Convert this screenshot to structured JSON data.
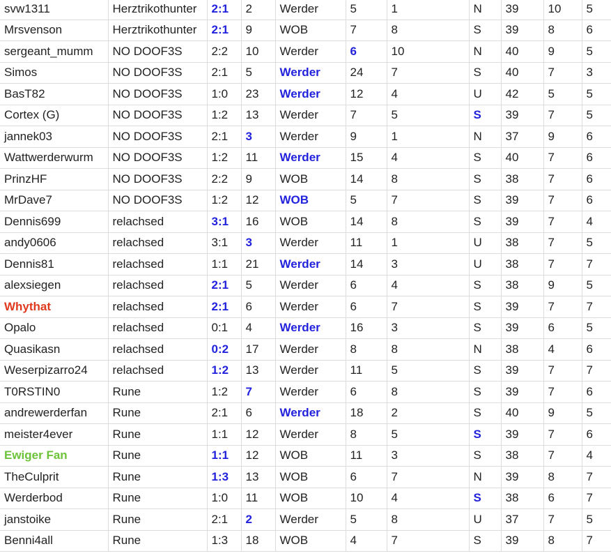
{
  "styles": {
    "highlight_color": "#2222dd",
    "name_red": "#e03a1e",
    "name_green": "#6cc33a",
    "border_color": "#dcdcdc"
  },
  "rows": [
    {
      "name": "svw1311",
      "team": "Herztrikothunter",
      "tip": "2:1",
      "c4": "2",
      "club": "Werder",
      "c6": "5",
      "c7": "1",
      "c8": "N",
      "c9": "39",
      "c10": "10",
      "c11": "5",
      "hl": [
        "tip"
      ]
    },
    {
      "name": "Mrsvenson",
      "team": "Herztrikothunter",
      "tip": "2:1",
      "c4": "9",
      "club": "WOB",
      "c6": "7",
      "c7": "8",
      "c8": "S",
      "c9": "39",
      "c10": "8",
      "c11": "6",
      "hl": [
        "tip"
      ]
    },
    {
      "name": "sergeant_mumm",
      "team": "NO DOOF3S",
      "tip": "2:2",
      "c4": "10",
      "club": "Werder",
      "c6": "6",
      "c7": "10",
      "c8": "N",
      "c9": "40",
      "c10": "9",
      "c11": "5",
      "hl": [
        "c6"
      ]
    },
    {
      "name": "Simos",
      "team": "NO DOOF3S",
      "tip": "2:1",
      "c4": "5",
      "club": "Werder",
      "c6": "24",
      "c7": "7",
      "c8": "S",
      "c9": "40",
      "c10": "7",
      "c11": "3",
      "hl": [
        "club"
      ]
    },
    {
      "name": "BasT82",
      "team": "NO DOOF3S",
      "tip": "1:0",
      "c4": "23",
      "club": "Werder",
      "c6": "12",
      "c7": "4",
      "c8": "U",
      "c9": "42",
      "c10": "5",
      "c11": "5",
      "hl": [
        "club"
      ]
    },
    {
      "name": "Cortex (G)",
      "team": "NO DOOF3S",
      "tip": "1:2",
      "c4": "13",
      "club": "Werder",
      "c6": "7",
      "c7": "5",
      "c8": "S",
      "c9": "39",
      "c10": "7",
      "c11": "5",
      "hl": [
        "c8"
      ]
    },
    {
      "name": "jannek03",
      "team": "NO DOOF3S",
      "tip": "2:1",
      "c4": "3",
      "club": "Werder",
      "c6": "9",
      "c7": "1",
      "c8": "N",
      "c9": "37",
      "c10": "9",
      "c11": "6",
      "hl": [
        "c4"
      ]
    },
    {
      "name": "Wattwerderwurm",
      "team": "NO DOOF3S",
      "tip": "1:2",
      "c4": "11",
      "club": "Werder",
      "c6": "15",
      "c7": "4",
      "c8": "S",
      "c9": "40",
      "c10": "7",
      "c11": "6",
      "hl": [
        "club"
      ]
    },
    {
      "name": "PrinzHF",
      "team": "NO DOOF3S",
      "tip": "2:2",
      "c4": "9",
      "club": "WOB",
      "c6": "14",
      "c7": "8",
      "c8": "S",
      "c9": "38",
      "c10": "7",
      "c11": "6",
      "hl": []
    },
    {
      "name": "MrDave7",
      "team": "NO DOOF3S",
      "tip": "1:2",
      "c4": "12",
      "club": "WOB",
      "c6": "5",
      "c7": "7",
      "c8": "S",
      "c9": "39",
      "c10": "7",
      "c11": "6",
      "hl": [
        "club"
      ]
    },
    {
      "name": "Dennis699",
      "team": "relachsed",
      "tip": "3:1",
      "c4": "16",
      "club": "WOB",
      "c6": "14",
      "c7": "8",
      "c8": "S",
      "c9": "39",
      "c10": "7",
      "c11": "4",
      "hl": [
        "tip"
      ]
    },
    {
      "name": "andy0606",
      "team": "relachsed",
      "tip": "3:1",
      "c4": "3",
      "club": "Werder",
      "c6": "11",
      "c7": "1",
      "c8": "U",
      "c9": "38",
      "c10": "7",
      "c11": "5",
      "hl": [
        "c4"
      ]
    },
    {
      "name": "Dennis81",
      "team": "relachsed",
      "tip": "1:1",
      "c4": "21",
      "club": "Werder",
      "c6": "14",
      "c7": "3",
      "c8": "U",
      "c9": "38",
      "c10": "7",
      "c11": "7",
      "hl": [
        "club"
      ]
    },
    {
      "name": "alexsiegen",
      "team": "relachsed",
      "tip": "2:1",
      "c4": "5",
      "club": "Werder",
      "c6": "6",
      "c7": "4",
      "c8": "S",
      "c9": "38",
      "c10": "9",
      "c11": "5",
      "hl": [
        "tip"
      ]
    },
    {
      "name": "Whythat",
      "team": "relachsed",
      "tip": "2:1",
      "c4": "6",
      "club": "Werder",
      "c6": "6",
      "c7": "7",
      "c8": "S",
      "c9": "39",
      "c10": "7",
      "c11": "7",
      "hl": [
        "tip"
      ],
      "name_color": "red"
    },
    {
      "name": "Opalo",
      "team": "relachsed",
      "tip": "0:1",
      "c4": "4",
      "club": "Werder",
      "c6": "16",
      "c7": "3",
      "c8": "S",
      "c9": "39",
      "c10": "6",
      "c11": "5",
      "hl": [
        "club"
      ]
    },
    {
      "name": "Quasikasn",
      "team": "relachsed",
      "tip": "0:2",
      "c4": "17",
      "club": "Werder",
      "c6": "8",
      "c7": "8",
      "c8": "N",
      "c9": "38",
      "c10": "4",
      "c11": "6",
      "hl": [
        "tip"
      ]
    },
    {
      "name": "Weserpizarro24",
      "team": "relachsed",
      "tip": "1:2",
      "c4": "13",
      "club": "Werder",
      "c6": "11",
      "c7": "5",
      "c8": "S",
      "c9": "39",
      "c10": "7",
      "c11": "7",
      "hl": [
        "tip"
      ]
    },
    {
      "name": "T0RSTIN0",
      "team": "Rune",
      "tip": "1:2",
      "c4": "7",
      "club": "Werder",
      "c6": "6",
      "c7": "8",
      "c8": "S",
      "c9": "39",
      "c10": "7",
      "c11": "6",
      "hl": [
        "c4"
      ]
    },
    {
      "name": "andrewerderfan",
      "team": "Rune",
      "tip": "2:1",
      "c4": "6",
      "club": "Werder",
      "c6": "18",
      "c7": "2",
      "c8": "S",
      "c9": "40",
      "c10": "9",
      "c11": "5",
      "hl": [
        "club"
      ]
    },
    {
      "name": "meister4ever",
      "team": "Rune",
      "tip": "1:1",
      "c4": "12",
      "club": "Werder",
      "c6": "8",
      "c7": "5",
      "c8": "S",
      "c9": "39",
      "c10": "7",
      "c11": "6",
      "hl": [
        "c8"
      ]
    },
    {
      "name": "Ewiger Fan",
      "team": "Rune",
      "tip": "1:1",
      "c4": "12",
      "club": "WOB",
      "c6": "11",
      "c7": "3",
      "c8": "S",
      "c9": "38",
      "c10": "7",
      "c11": "4",
      "hl": [
        "tip"
      ],
      "name_color": "green"
    },
    {
      "name": "TheCulprit",
      "team": "Rune",
      "tip": "1:3",
      "c4": "13",
      "club": "WOB",
      "c6": "6",
      "c7": "7",
      "c8": "N",
      "c9": "39",
      "c10": "8",
      "c11": "7",
      "hl": [
        "tip"
      ]
    },
    {
      "name": "Werderbod",
      "team": "Rune",
      "tip": "1:0",
      "c4": "11",
      "club": "WOB",
      "c6": "10",
      "c7": "4",
      "c8": "S",
      "c9": "38",
      "c10": "6",
      "c11": "7",
      "hl": [
        "c8"
      ]
    },
    {
      "name": "janstoike",
      "team": "Rune",
      "tip": "2:1",
      "c4": "2",
      "club": "Werder",
      "c6": "5",
      "c7": "8",
      "c8": "U",
      "c9": "37",
      "c10": "7",
      "c11": "5",
      "hl": [
        "c4"
      ]
    },
    {
      "name": "Benni4all",
      "team": "Rune",
      "tip": "1:3",
      "c4": "18",
      "club": "WOB",
      "c6": "4",
      "c7": "7",
      "c8": "S",
      "c9": "39",
      "c10": "8",
      "c11": "7",
      "hl": []
    }
  ]
}
